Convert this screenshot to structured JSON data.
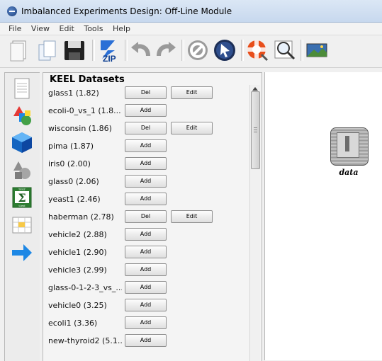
{
  "window": {
    "title": "Imbalanced Experiments Design: Off-Line Module"
  },
  "menu": [
    "File",
    "View",
    "Edit",
    "Tools",
    "Help"
  ],
  "toolbar": {
    "icons": [
      "new-document-icon",
      "open-document-icon",
      "save-disk-icon",
      "zip-export-icon",
      "undo-icon",
      "redo-icon",
      "stop-icon",
      "select-pointer-icon",
      "help-lifebuoy-icon",
      "zoom-search-icon",
      "landscape-image-icon"
    ],
    "zip_label": "ZIP"
  },
  "left_tools": [
    "document-icon",
    "shapes-icon",
    "blue-cube-icon",
    "grey-shapes-icon",
    "sigma-test-icon",
    "table-grid-icon",
    "blue-arrow-icon"
  ],
  "sigma": {
    "top": "TEST",
    "symbol": "Σ",
    "bottom": "t-test"
  },
  "panel": {
    "title": "KEEL Datasets",
    "datasets": [
      {
        "name": "glass1 (1.82)",
        "primary": "Del",
        "secondary": "Edit"
      },
      {
        "name": "ecoli-0_vs_1 (1.8...",
        "primary": "Add",
        "secondary": ""
      },
      {
        "name": "wisconsin (1.86)",
        "primary": "Del",
        "secondary": "Edit"
      },
      {
        "name": "pima (1.87)",
        "primary": "Add",
        "secondary": ""
      },
      {
        "name": "iris0 (2.00)",
        "primary": "Add",
        "secondary": ""
      },
      {
        "name": "glass0 (2.06)",
        "primary": "Add",
        "secondary": ""
      },
      {
        "name": "yeast1 (2.46)",
        "primary": "Add",
        "secondary": ""
      },
      {
        "name": "haberman (2.78)",
        "primary": "Del",
        "secondary": "Edit"
      },
      {
        "name": "vehicle2 (2.88)",
        "primary": "Add",
        "secondary": ""
      },
      {
        "name": "vehicle1 (2.90)",
        "primary": "Add",
        "secondary": ""
      },
      {
        "name": "vehicle3 (2.99)",
        "primary": "Add",
        "secondary": ""
      },
      {
        "name": "glass-0-1-2-3_vs_...",
        "primary": "Add",
        "secondary": ""
      },
      {
        "name": "vehicle0 (3.25)",
        "primary": "Add",
        "secondary": ""
      },
      {
        "name": "ecoli1 (3.36)",
        "primary": "Add",
        "secondary": ""
      },
      {
        "name": "new-thyroid2 (5.1...",
        "primary": "Add",
        "secondary": ""
      }
    ]
  },
  "canvas": {
    "node_label": "data"
  }
}
